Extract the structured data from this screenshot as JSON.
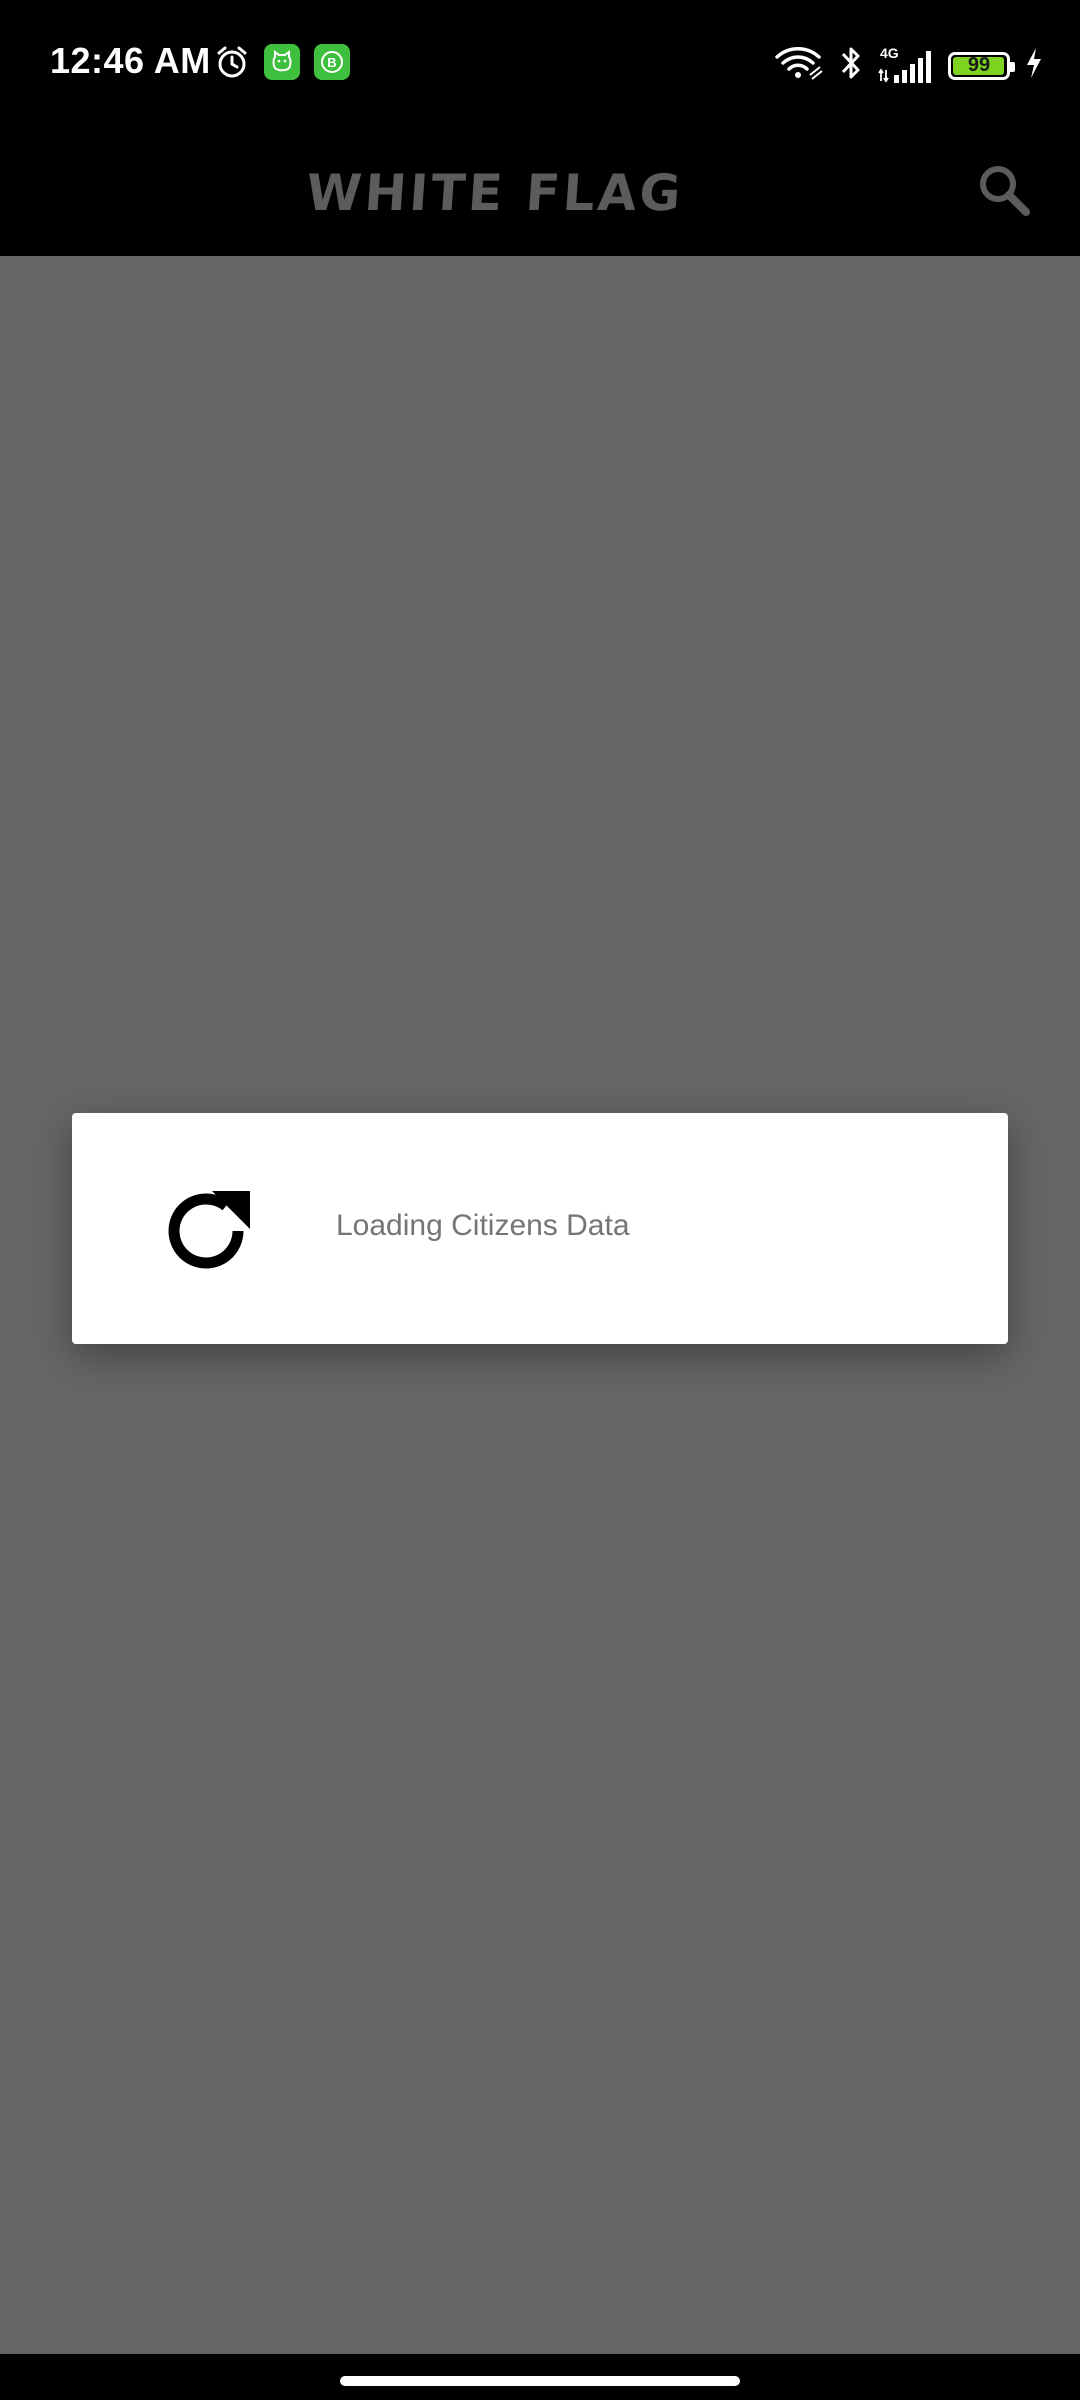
{
  "status_bar": {
    "time": "12:46 AM",
    "left_icons": [
      "alarm-icon",
      "cat-app-icon",
      "b-app-icon"
    ],
    "right_icons": [
      "wifi-icon",
      "bluetooth-icon",
      "signal-icon",
      "battery-icon",
      "charging-icon"
    ],
    "network_type": "4G",
    "battery_level": "99",
    "battery_fraction": 0.99,
    "colors": {
      "app_badge": "#3ec03e",
      "battery_fill": "#7ed321"
    }
  },
  "toolbar": {
    "title": "WHITE FLAG",
    "search_icon": "search-icon"
  },
  "dialog": {
    "icon": "refresh-icon",
    "message": "Loading Citizens Data"
  },
  "colors": {
    "background": "#000000",
    "scrim": "rgba(0,0,0,0.6)",
    "title": "#5c5c5c",
    "dialog_text": "#757575"
  }
}
